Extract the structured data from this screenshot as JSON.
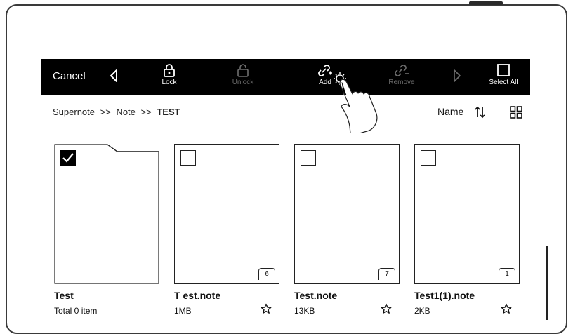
{
  "toolbar": {
    "cancel_label": "Cancel",
    "lock_label": "Lock",
    "unlock_label": "Unlock",
    "add_label": "Add",
    "remove_label": "Remove",
    "select_all_label": "Select All"
  },
  "breadcrumb": {
    "part1": "Supernote",
    "sep1": ">>",
    "part2": "Note",
    "sep2": ">>",
    "current": "TEST"
  },
  "sort": {
    "label": "Name"
  },
  "items": [
    {
      "name": "Test",
      "meta": "Total 0 item",
      "type": "folder",
      "checked": true
    },
    {
      "name": "T est.note",
      "meta": "1MB",
      "pages": "6",
      "type": "note",
      "checked": false
    },
    {
      "name": "Test.note",
      "meta": "13KB",
      "pages": "7",
      "type": "note",
      "checked": false
    },
    {
      "name": "Test1(1).note",
      "meta": "2KB",
      "pages": "1",
      "type": "note",
      "checked": false
    }
  ],
  "colors": {
    "toolbar_bg": "#000000",
    "disabled_text": "#6e6e6e"
  },
  "icons": [
    "back-arrow-icon",
    "lock-icon",
    "unlock-icon",
    "link-add-icon",
    "link-remove-icon",
    "forward-arrow-icon",
    "select-all-icon",
    "sort-icon",
    "grid-view-icon",
    "star-icon",
    "checkbox-icon",
    "hand-pointer-icon"
  ]
}
